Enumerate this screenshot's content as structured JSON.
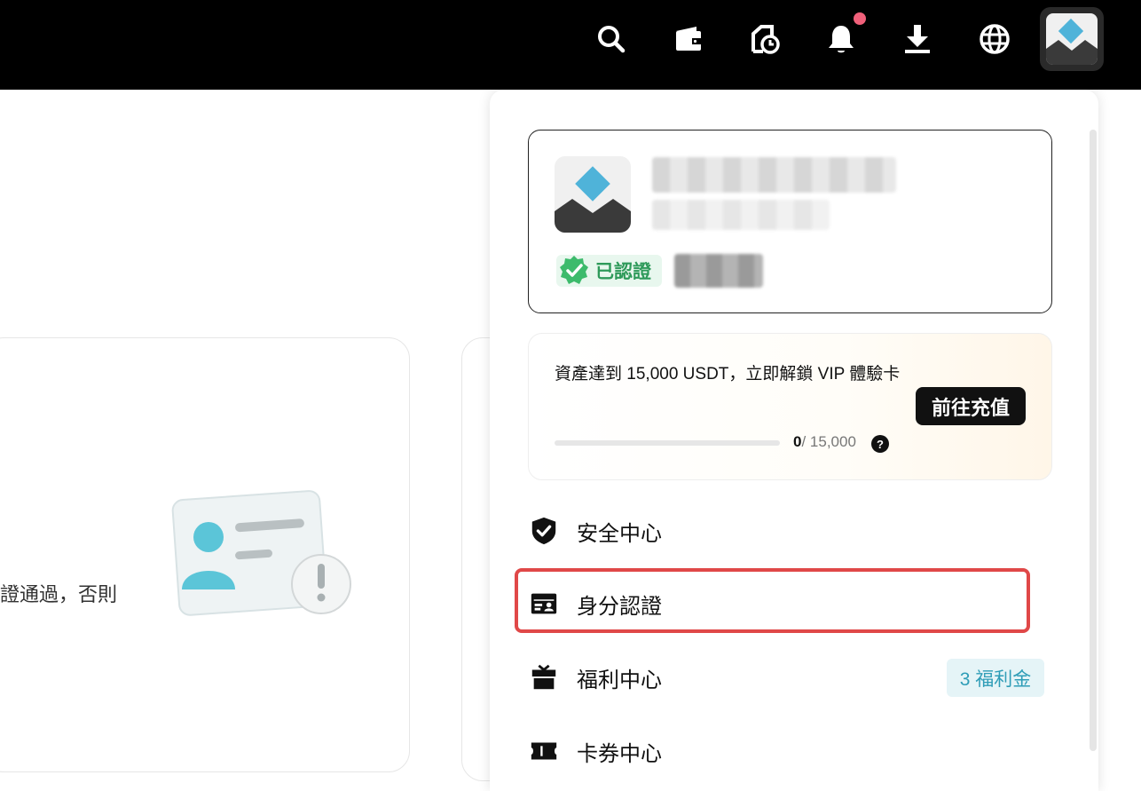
{
  "topbar": {
    "icons": [
      "search-icon",
      "wallet-icon",
      "order-history-icon",
      "bell-icon",
      "download-icon",
      "globe-icon"
    ],
    "notification_dot_color": "#f0607a"
  },
  "background": {
    "partial_text": "證通過，否則"
  },
  "profile": {
    "verified_label": "已認證",
    "verified_color": "#2e9a5a"
  },
  "vip": {
    "description": "資產達到 15,000 USDT，立即解鎖 VIP 體驗卡",
    "progress_current": "0",
    "progress_total": "/ 15,000",
    "progress_fraction": 0,
    "help_label": "?",
    "deposit_button": "前往充值"
  },
  "menu": {
    "items": [
      {
        "label": "安全中心",
        "icon": "shield-check-icon"
      },
      {
        "label": "身分認證",
        "icon": "id-card-icon"
      },
      {
        "label": "福利中心",
        "icon": "gift-icon"
      },
      {
        "label": "卡券中心",
        "icon": "ticket-icon"
      }
    ],
    "welfare_badge": "3 福利金",
    "highlight_color": "#e04848"
  }
}
